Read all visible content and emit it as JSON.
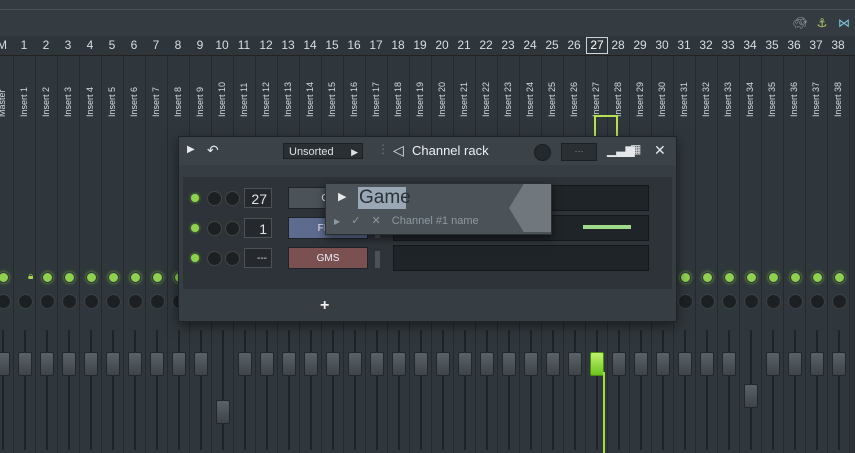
{
  "topbar": {
    "icons": [
      "tortoise-icon",
      "pin-icon",
      "snap-icon"
    ]
  },
  "mixer": {
    "track_numbers": [
      "M",
      "1",
      "2",
      "3",
      "4",
      "5",
      "6",
      "7",
      "8",
      "9",
      "10",
      "11",
      "12",
      "13",
      "14",
      "15",
      "16",
      "17",
      "18",
      "19",
      "20",
      "21",
      "22",
      "23",
      "24",
      "25",
      "26",
      "27",
      "28",
      "29",
      "30",
      "31",
      "32",
      "33",
      "34",
      "35",
      "36",
      "37",
      "38"
    ],
    "selected_track": "27",
    "master_label": "Master",
    "insert_labels": [
      "Insert 1",
      "Insert 2",
      "Insert 3",
      "Insert 4",
      "Insert 5",
      "Insert 6",
      "Insert 7",
      "Insert 8",
      "Insert 9",
      "Insert 10",
      "Insert 11",
      "Insert 12",
      "Insert 13",
      "Insert 14",
      "Insert 15",
      "Insert 16",
      "Insert 17",
      "Insert 18",
      "Insert 19",
      "Insert 20",
      "Insert 21",
      "Insert 22",
      "Insert 23",
      "Insert 24",
      "Insert 25",
      "Insert 26",
      "Insert 27",
      "Insert 28",
      "Insert 29",
      "Insert 30",
      "Insert 31",
      "Insert 32",
      "Insert 33",
      "Insert 34",
      "Insert 35",
      "Insert 36",
      "Insert 37",
      "Insert 38"
    ],
    "accent": "#9be23f"
  },
  "rack": {
    "title": "Channel rack",
    "filter": "Unsorted",
    "add_label": "+",
    "channels": [
      {
        "route": "27",
        "name": "Ga",
        "color": "#4b5258"
      },
      {
        "route": "1",
        "name": "FL K",
        "color": "#5d6b8f"
      },
      {
        "route": "---",
        "name": "GMS",
        "color": "#7a5150"
      }
    ]
  },
  "rename": {
    "value": "Game",
    "hint": "Channel #1 name",
    "confirm": "✓",
    "cancel": "✕"
  }
}
